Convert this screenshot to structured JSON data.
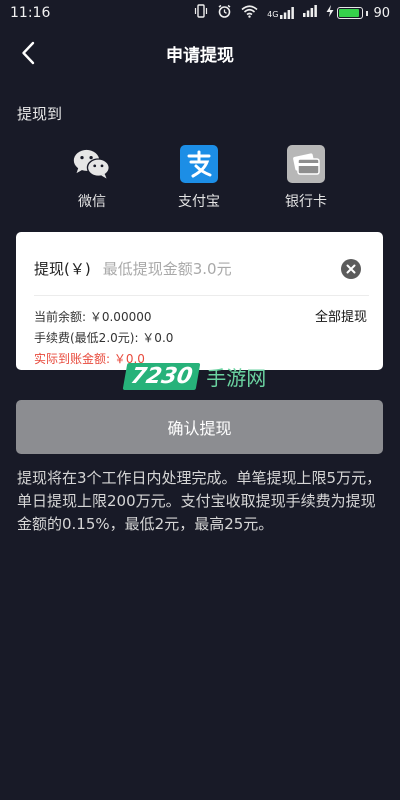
{
  "status_bar": {
    "time": "11:16",
    "network": "4G",
    "battery": "90",
    "battery_level": 0.9
  },
  "header": {
    "title": "申请提现",
    "back_icon": "chevron-left-icon"
  },
  "withdraw_to": {
    "label": "提现到",
    "methods": [
      {
        "label": "微信",
        "icon": "wechat-icon"
      },
      {
        "label": "支付宝",
        "icon": "alipay-icon"
      },
      {
        "label": "银行卡",
        "icon": "bank-card-icon"
      }
    ]
  },
  "card": {
    "amount_label": "提现(￥)",
    "amount_value": "",
    "amount_placeholder": "最低提现金额3.0元",
    "balance": "当前余额: ￥0.00000",
    "fee": "手续费(最低2.0元): ￥0.0",
    "actual": "实际到账金额: ￥0.0",
    "withdraw_all": "全部提现"
  },
  "watermark": {
    "badge": "7230",
    "text": "手游网"
  },
  "confirm_label": "确认提现",
  "notice": "提现将在3个工作日内处理完成。单笔提现上限5万元，单日提现上限200万元。支付宝收取提现手续费为提现金额的0.15%，最低2元，最高25元。",
  "colors": {
    "background": "#181a27",
    "card": "#ffffff",
    "alipay": "#1c8ee6",
    "wechat": "#e6e6e6",
    "warning_text": "#e84a3c",
    "button_disabled": "#8c8d91",
    "watermark_green": "#27b27a"
  }
}
